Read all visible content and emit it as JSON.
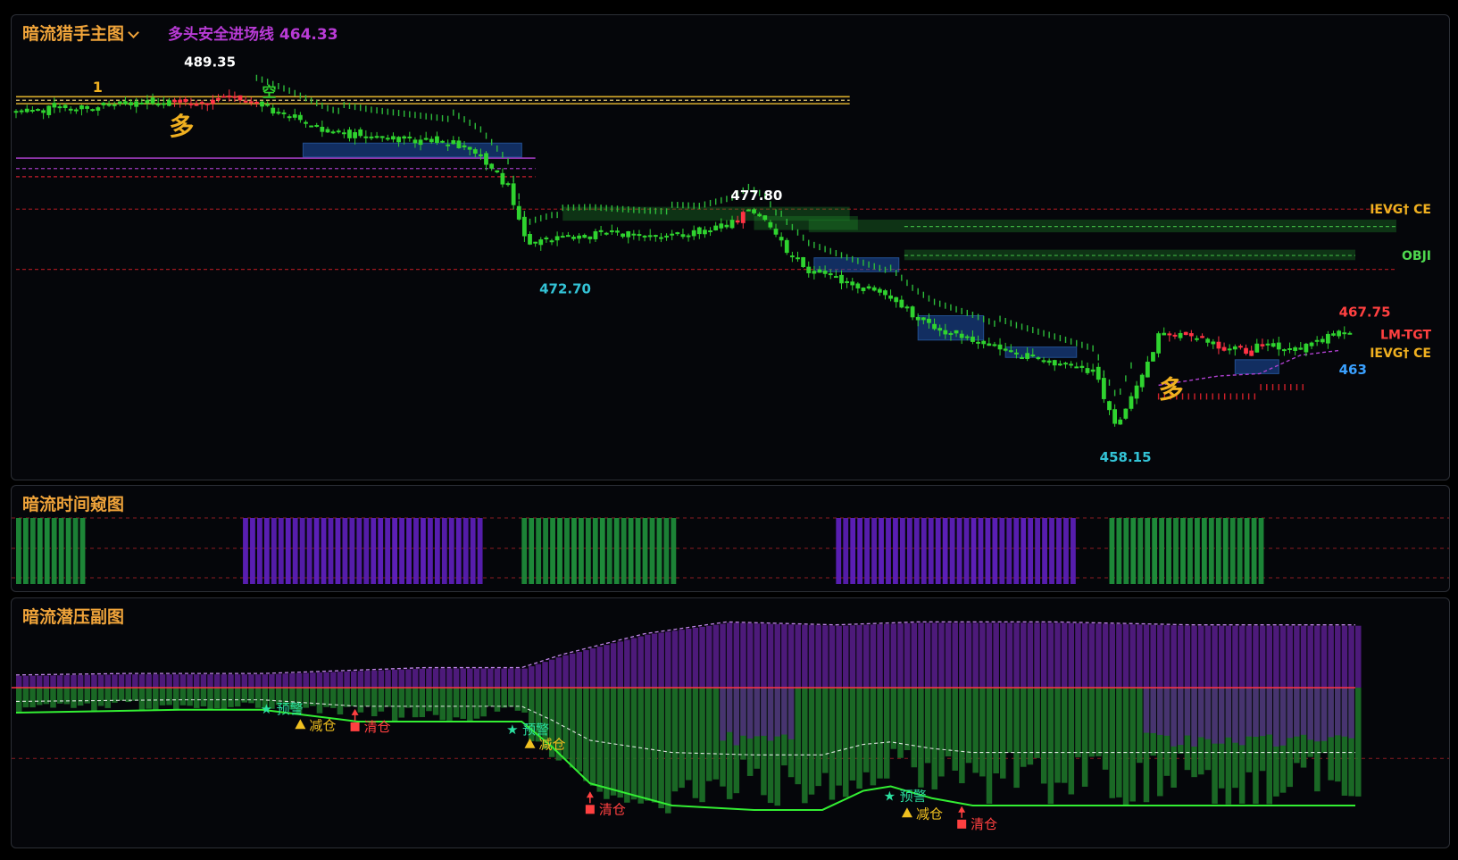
{
  "main_panel": {
    "title": "暗流猎手主图",
    "entry_line_label": "多头安全进场线",
    "entry_line_value": "464.33"
  },
  "time_panel": {
    "title": "暗流时间窥图"
  },
  "pressure_panel": {
    "title": "暗流潜压副图"
  },
  "colors": {
    "up": "#2fd32f",
    "down": "#ff3344",
    "title": "#f0a43a",
    "purple": "#9933dd",
    "green_bar": "#1e8c3a",
    "cyan_label": "#33c3d6"
  },
  "chart_data": [
    {
      "type": "line",
      "panel": "main",
      "ylim": [
        456,
        493
      ],
      "price_path": [
        {
          "x": 0,
          "y": 486.2
        },
        {
          "x": 20,
          "y": 486.6
        },
        {
          "x": 40,
          "y": 486.9
        },
        {
          "x": 60,
          "y": 487.1
        },
        {
          "x": 80,
          "y": 487.2
        },
        {
          "x": 90,
          "y": 486.6
        },
        {
          "x": 100,
          "y": 485.8
        },
        {
          "x": 115,
          "y": 484.4
        },
        {
          "x": 130,
          "y": 484.0
        },
        {
          "x": 160,
          "y": 483.6
        },
        {
          "x": 170,
          "y": 482.3
        },
        {
          "x": 180,
          "y": 479.7
        },
        {
          "x": 187,
          "y": 474.5
        },
        {
          "x": 190,
          "y": 474.8
        },
        {
          "x": 196,
          "y": 475.3
        },
        {
          "x": 210,
          "y": 475.6
        },
        {
          "x": 230,
          "y": 475.6
        },
        {
          "x": 250,
          "y": 475.7
        },
        {
          "x": 262,
          "y": 476.6
        },
        {
          "x": 268,
          "y": 477.6
        },
        {
          "x": 274,
          "y": 476.9
        },
        {
          "x": 282,
          "y": 474.2
        },
        {
          "x": 290,
          "y": 472.5
        },
        {
          "x": 305,
          "y": 471.4
        },
        {
          "x": 318,
          "y": 470.6
        },
        {
          "x": 328,
          "y": 468.6
        },
        {
          "x": 336,
          "y": 467.5
        },
        {
          "x": 350,
          "y": 466.6
        },
        {
          "x": 365,
          "y": 465.4
        },
        {
          "x": 385,
          "y": 464.3
        },
        {
          "x": 395,
          "y": 463.7
        },
        {
          "x": 400,
          "y": 460.3
        },
        {
          "x": 403,
          "y": 459.0
        },
        {
          "x": 408,
          "y": 461.9
        },
        {
          "x": 413,
          "y": 464.2
        },
        {
          "x": 418,
          "y": 466.8
        },
        {
          "x": 428,
          "y": 467.2
        },
        {
          "x": 440,
          "y": 466.0
        },
        {
          "x": 450,
          "y": 465.5
        },
        {
          "x": 458,
          "y": 466.3
        },
        {
          "x": 464,
          "y": 465.7
        },
        {
          "x": 472,
          "y": 465.9
        },
        {
          "x": 478,
          "y": 466.6
        },
        {
          "x": 484,
          "y": 467.2
        }
      ],
      "annotations": [
        {
          "text": "489.35",
          "x": 68,
          "y": 489.35
        },
        {
          "text": "477.80",
          "x": 268,
          "y": 477.8
        },
        {
          "text": "472.70",
          "x": 198,
          "y": 472.7
        },
        {
          "text": "458.15",
          "x": 403,
          "y": 458.15
        },
        {
          "text": "467.75",
          "x": 484,
          "y": 467.75
        },
        {
          "text": "463",
          "x": 484,
          "y": 464.0
        }
      ],
      "markers": [
        {
          "text": "空",
          "x": 90,
          "y": 487.5
        },
        {
          "text": "多",
          "x": 56,
          "y": 484.2
        },
        {
          "text": "多",
          "x": 418,
          "y": 461.5
        },
        {
          "text": "1",
          "x": 28,
          "y": 487.9
        }
      ],
      "side_labels": [
        {
          "text": "IEVG† CE",
          "y": 477.8
        },
        {
          "text": "OBJI",
          "y": 473.8
        },
        {
          "text": "LM-TGT",
          "y": 467.0
        },
        {
          "text": "IEVG† CE",
          "y": 465.4
        }
      ],
      "levels": [
        {
          "y": 487.5,
          "x": [
            0,
            305
          ],
          "color": "#f0c030",
          "style": "solid"
        },
        {
          "y": 487.2,
          "x": [
            0,
            305
          ],
          "color": "#ffe080",
          "style": "dashed"
        },
        {
          "y": 486.9,
          "x": [
            0,
            305
          ],
          "color": "#f0c030",
          "style": "solid"
        },
        {
          "y": 482.2,
          "x": [
            0,
            190
          ],
          "color": "#b040d0",
          "style": "solid"
        },
        {
          "y": 481.3,
          "x": [
            0,
            190
          ],
          "color": "#b040d0",
          "style": "dashed"
        },
        {
          "y": 480.6,
          "x": [
            0,
            190
          ],
          "color": "#e02030",
          "style": "dashed"
        },
        {
          "y": 477.8,
          "x": [
            0,
            505
          ],
          "color": "#b01a22",
          "style": "dashed"
        },
        {
          "y": 472.6,
          "x": [
            0,
            505
          ],
          "color": "#b01a22",
          "style": "dashed"
        },
        {
          "y": 476.3,
          "x": [
            325,
            505
          ],
          "color": "#55dd55",
          "style": "dashed"
        },
        {
          "y": 473.8,
          "x": [
            325,
            490
          ],
          "color": "#55dd55",
          "style": "dashed"
        }
      ]
    },
    {
      "type": "bar",
      "panel": "time",
      "segments": [
        {
          "x_start": 0,
          "x_end": 26,
          "color": "green"
        },
        {
          "x_start": 83,
          "x_end": 170,
          "color": "purple"
        },
        {
          "x_start": 185,
          "x_end": 242,
          "color": "green"
        },
        {
          "x_start": 300,
          "x_end": 386,
          "color": "purple"
        },
        {
          "x_start": 400,
          "x_end": 457,
          "color": "green"
        }
      ]
    },
    {
      "type": "area",
      "panel": "pressure",
      "ylim": [
        -100,
        60
      ],
      "upper_band": [
        {
          "x": 0,
          "y": 8
        },
        {
          "x": 40,
          "y": 9
        },
        {
          "x": 90,
          "y": 9
        },
        {
          "x": 120,
          "y": 11
        },
        {
          "x": 150,
          "y": 13
        },
        {
          "x": 185,
          "y": 13
        },
        {
          "x": 200,
          "y": 22
        },
        {
          "x": 230,
          "y": 36
        },
        {
          "x": 260,
          "y": 44
        },
        {
          "x": 300,
          "y": 42
        },
        {
          "x": 330,
          "y": 44
        },
        {
          "x": 380,
          "y": 44
        },
        {
          "x": 430,
          "y": 42
        },
        {
          "x": 490,
          "y": 42
        }
      ],
      "lower_line": [
        {
          "x": 0,
          "y": -17
        },
        {
          "x": 60,
          "y": -15
        },
        {
          "x": 90,
          "y": -15
        },
        {
          "x": 125,
          "y": -23
        },
        {
          "x": 185,
          "y": -23
        },
        {
          "x": 196,
          "y": -40
        },
        {
          "x": 210,
          "y": -65
        },
        {
          "x": 240,
          "y": -80
        },
        {
          "x": 270,
          "y": -83
        },
        {
          "x": 295,
          "y": -83
        },
        {
          "x": 310,
          "y": -70
        },
        {
          "x": 320,
          "y": -67
        },
        {
          "x": 335,
          "y": -75
        },
        {
          "x": 350,
          "y": -80
        },
        {
          "x": 400,
          "y": -80
        },
        {
          "x": 490,
          "y": -80
        }
      ],
      "signals": [
        {
          "text": "预警",
          "x": 92,
          "y": -14,
          "kind": "star"
        },
        {
          "text": "减仓",
          "x": 104,
          "y": -25,
          "kind": "triangle"
        },
        {
          "text": "清仓",
          "x": 124,
          "y": -26,
          "kind": "square"
        },
        {
          "text": "预警",
          "x": 182,
          "y": -28,
          "kind": "star"
        },
        {
          "text": "减仓",
          "x": 188,
          "y": -38,
          "kind": "triangle"
        },
        {
          "text": "清仓",
          "x": 210,
          "y": -82,
          "kind": "square"
        },
        {
          "text": "预警",
          "x": 320,
          "y": -73,
          "kind": "star"
        },
        {
          "text": "减仓",
          "x": 326,
          "y": -85,
          "kind": "triangle"
        },
        {
          "text": "清仓",
          "x": 346,
          "y": -92,
          "kind": "square"
        }
      ]
    }
  ]
}
